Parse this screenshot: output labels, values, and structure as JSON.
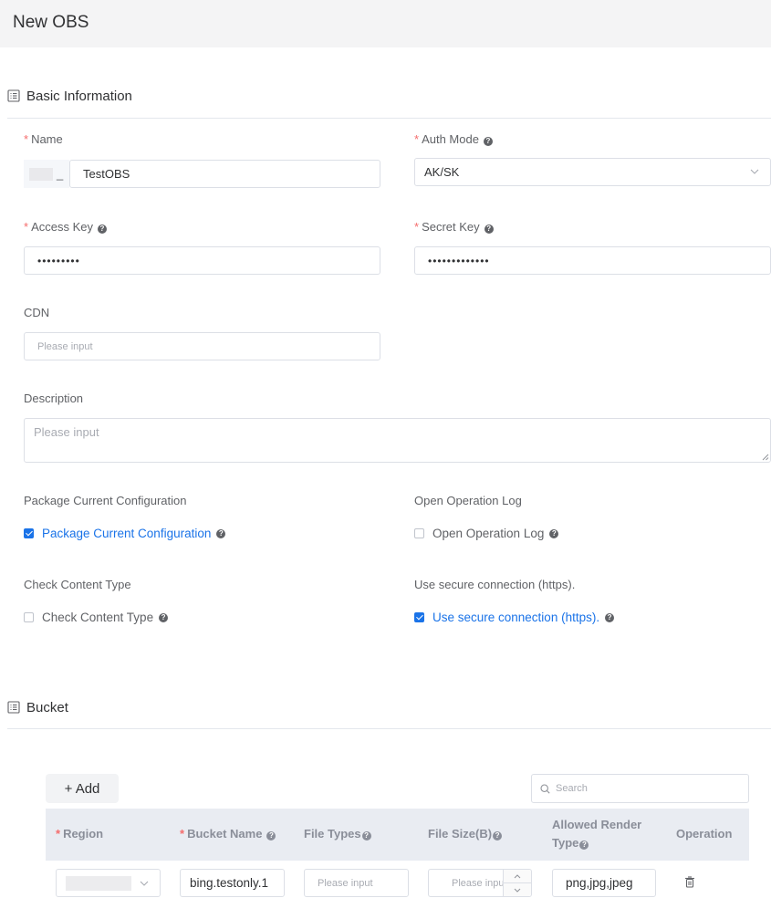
{
  "page": {
    "title": "New OBS"
  },
  "basic": {
    "heading": "Basic Information",
    "name": {
      "label": "Name",
      "prefix": "_",
      "value": "TestOBS"
    },
    "auth_mode": {
      "label": "Auth Mode",
      "value": "AK/SK"
    },
    "access_key": {
      "label": "Access Key",
      "value": "•••••••••"
    },
    "secret_key": {
      "label": "Secret Key",
      "value": "•••••••••••••"
    },
    "cdn": {
      "label": "CDN",
      "placeholder": "Please input"
    },
    "description": {
      "label": "Description",
      "placeholder": "Please input"
    },
    "package_config": {
      "label": "Package Current Configuration",
      "option": "Package Current Configuration",
      "checked": true
    },
    "operation_log": {
      "label": "Open Operation Log",
      "option": "Open Operation Log",
      "checked": false
    },
    "check_content_type": {
      "label": "Check Content Type",
      "option": "Check Content Type",
      "checked": false
    },
    "secure_connection": {
      "label": "Use secure connection (https).",
      "option": "Use secure connection (https).",
      "checked": true
    }
  },
  "bucket": {
    "heading": "Bucket",
    "add_label": "+ Add",
    "search_placeholder": "Search",
    "columns": {
      "region": "Region",
      "bucket_name": "Bucket Name",
      "file_types": "File Types",
      "file_size": "File Size(B)",
      "allowed_render_type_line1": "Allowed Render",
      "allowed_render_type_line2": "Type",
      "operation": "Operation"
    },
    "row": {
      "bucket_name": "bing.testonly.1",
      "file_types_placeholder": "Please input",
      "file_size_placeholder": "Please input",
      "allowed_render_type": "png,jpg,jpeg"
    }
  },
  "colors": {
    "accent": "#1a73e8",
    "required": "#f56c6c",
    "header_bg": "#f4f4f5",
    "table_header_bg": "#e9ecf2"
  },
  "icons": {
    "section": "list-icon",
    "select": "chevron-down-icon",
    "help": "question-circle-icon",
    "search": "search-icon",
    "delete": "trash-icon"
  }
}
